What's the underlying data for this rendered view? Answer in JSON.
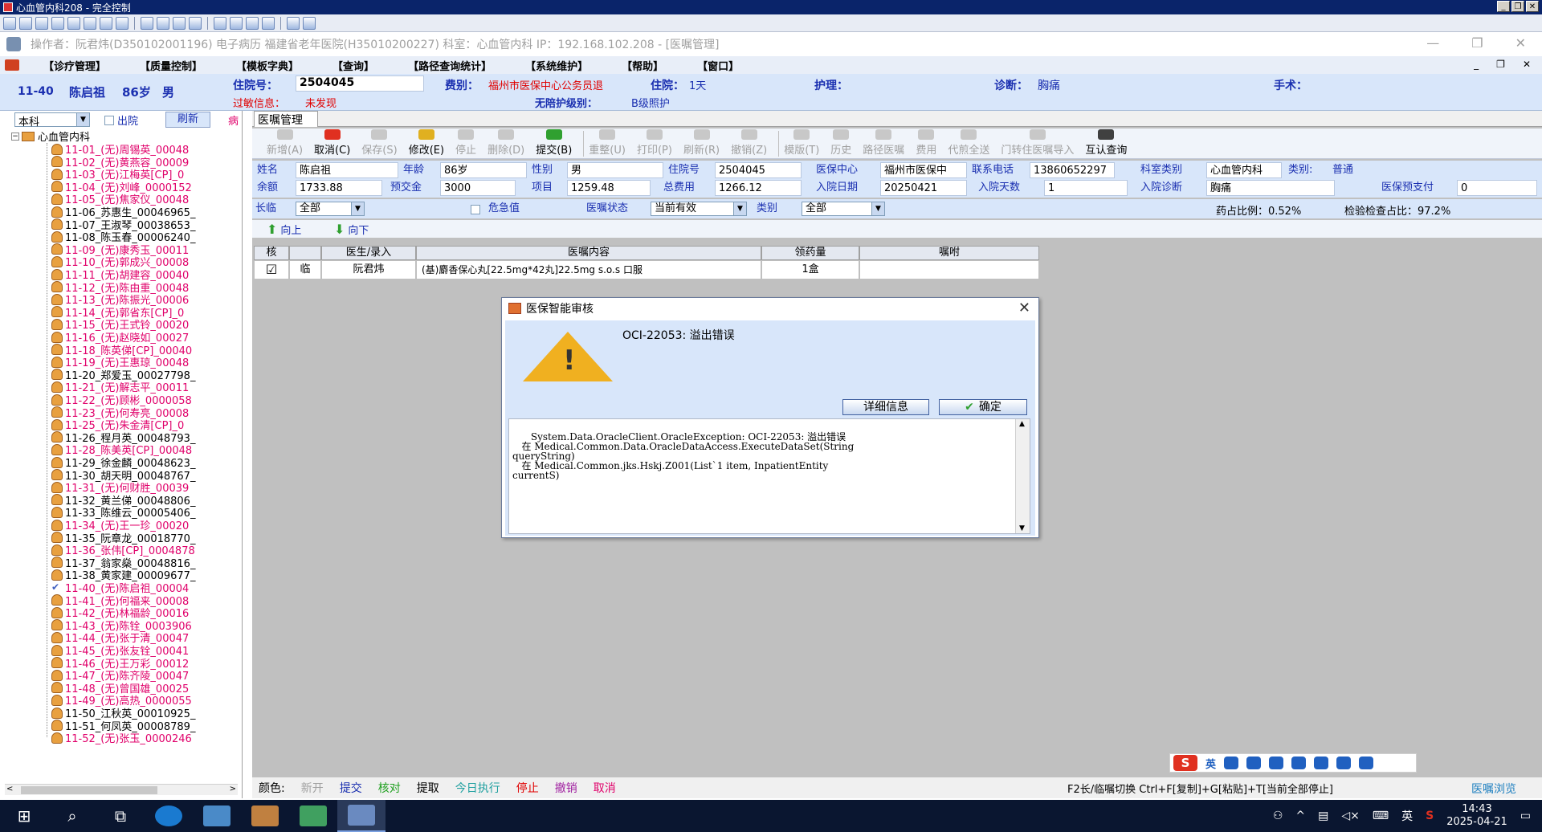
{
  "window": {
    "title": "心血管内科208 - 完全控制"
  },
  "appinfo": {
    "text": "操作者：阮君炜(D350102001196) 电子病历  福建省老年医院(H35010200227)  科室：心血管内科  IP：192.168.102.208 - [医嘱管理]",
    "min": "—",
    "max": "❐",
    "close": "✕"
  },
  "menu": {
    "items": [
      "【诊疗管理】",
      "【质量控制】",
      "【模板字典】",
      "【查询】",
      "【路径查询统计】",
      "【系统维护】",
      "【帮助】",
      "【窗口】"
    ],
    "mctl": [
      "_",
      "❐",
      "✕"
    ]
  },
  "patient": {
    "bed": "11-40",
    "name": "陈启祖",
    "age": "86岁",
    "sex": "男",
    "admission_label": "住院号：",
    "admission_no": "2504045",
    "allergy_label": "过敏信息：",
    "allergy_value": "未发现",
    "fee_label": "费别：",
    "fee_value": "福州市医保中心公务员退",
    "stay_label": "住院：",
    "stay_value": "1天",
    "care_level_label": "无陪护级别：",
    "care_level_value": "B级照护",
    "nursing_label": "护理：",
    "diag_label": "诊断：",
    "diag_value": "胸痛",
    "surgery_label": "手术："
  },
  "left": {
    "dept": "本科",
    "discharge_label": "出院",
    "refresh_label": "刷新",
    "tag": "病",
    "root": "心血管内科",
    "patients": [
      {
        "t": "11-01_(无)周锡英_00048",
        "c": "magenta"
      },
      {
        "t": "11-02_(无)黄燕容_00009",
        "c": "magenta"
      },
      {
        "t": "11-03_(无)江梅英[CP]_0",
        "c": "magenta"
      },
      {
        "t": "11-04_(无)刘峰_0000152",
        "c": "magenta"
      },
      {
        "t": "11-05_(无)焦家仪_00048",
        "c": "magenta"
      },
      {
        "t": "11-06_苏惠生_00046965_",
        "c": "black"
      },
      {
        "t": "11-07_王淑琴_00038653_",
        "c": "black"
      },
      {
        "t": "11-08_陈玉春_00006240_",
        "c": "black"
      },
      {
        "t": "11-09_(无)康秀玉_00011",
        "c": "magenta"
      },
      {
        "t": "11-10_(无)郭成兴_00008",
        "c": "magenta"
      },
      {
        "t": "11-11_(无)胡建容_00040",
        "c": "magenta"
      },
      {
        "t": "11-12_(无)陈由重_00048",
        "c": "magenta"
      },
      {
        "t": "11-13_(无)陈振光_00006",
        "c": "magenta"
      },
      {
        "t": "11-14_(无)郭省东[CP]_0",
        "c": "magenta"
      },
      {
        "t": "11-15_(无)王式铃_00020",
        "c": "magenta"
      },
      {
        "t": "11-16_(无)赵晓如_00027",
        "c": "magenta"
      },
      {
        "t": "11-18_陈英俤[CP]_00040",
        "c": "magenta"
      },
      {
        "t": "11-19_(无)王惠琼_00048",
        "c": "magenta"
      },
      {
        "t": "11-20_郑爱玉_00027798_",
        "c": "black"
      },
      {
        "t": "11-21_(无)解志平_00011",
        "c": "magenta"
      },
      {
        "t": "11-22_(无)顾彬_0000058",
        "c": "magenta"
      },
      {
        "t": "11-23_(无)何寿亮_00008",
        "c": "magenta"
      },
      {
        "t": "11-25_(无)朱金清[CP]_0",
        "c": "magenta"
      },
      {
        "t": "11-26_程月英_00048793_",
        "c": "black"
      },
      {
        "t": "11-28_陈美英[CP]_00048",
        "c": "magenta"
      },
      {
        "t": "11-29_徐金麟_00048623_",
        "c": "black"
      },
      {
        "t": "11-30_胡天明_00048767_",
        "c": "black"
      },
      {
        "t": "11-31_(无)何财胜_00039",
        "c": "magenta"
      },
      {
        "t": "11-32_黄兰俤_00048806_",
        "c": "black"
      },
      {
        "t": "11-33_陈维云_00005406_",
        "c": "black"
      },
      {
        "t": "11-34_(无)王一珍_00020",
        "c": "magenta"
      },
      {
        "t": "11-35_阮章龙_00018770_",
        "c": "black"
      },
      {
        "t": "11-36_张伟[CP]_0004878",
        "c": "magenta"
      },
      {
        "t": "11-37_翁家燊_00048816_",
        "c": "black"
      },
      {
        "t": "11-38_黄家建_00009677_",
        "c": "black"
      },
      {
        "t": "11-40_(无)陈启祖_00004",
        "c": "magenta",
        "checked": true
      },
      {
        "t": "11-41_(无)何福来_00008",
        "c": "magenta"
      },
      {
        "t": "11-42_(无)林福龄_00016",
        "c": "magenta"
      },
      {
        "t": "11-43_(无)陈铨_0003906",
        "c": "magenta"
      },
      {
        "t": "11-44_(无)张于清_00047",
        "c": "magenta"
      },
      {
        "t": "11-45_(无)张友铨_00041",
        "c": "magenta"
      },
      {
        "t": "11-46_(无)王万彩_00012",
        "c": "magenta"
      },
      {
        "t": "11-47_(无)陈齐陵_00047",
        "c": "magenta"
      },
      {
        "t": "11-48_(无)曾国雄_00025",
        "c": "magenta"
      },
      {
        "t": "11-49_(无)高热_0000055",
        "c": "magenta"
      },
      {
        "t": "11-50_江秋英_00010925_",
        "c": "black"
      },
      {
        "t": "11-51_何凤英_00008789_",
        "c": "black"
      },
      {
        "t": "11-52_(无)张玉_0000246",
        "c": "magenta"
      }
    ]
  },
  "tab": {
    "label": "医嘱管理"
  },
  "toolbar": [
    {
      "label": "新增(A)",
      "dis": true,
      "color": "#c8c8c8"
    },
    {
      "label": "取消(C)",
      "dis": false,
      "color": "#e03020"
    },
    {
      "label": "保存(S)",
      "dis": true,
      "color": "#c8c8c8"
    },
    {
      "label": "修改(E)",
      "dis": false,
      "color": "#e0b020"
    },
    {
      "label": "停止",
      "dis": true,
      "color": "#c8c8c8"
    },
    {
      "label": "删除(D)",
      "dis": true,
      "color": "#c8c8c8"
    },
    {
      "label": "提交(B)",
      "dis": false,
      "color": "#30a030"
    },
    {
      "label": "重整(U)",
      "dis": true,
      "color": "#c8c8c8"
    },
    {
      "label": "打印(P)",
      "dis": true,
      "color": "#c8c8c8"
    },
    {
      "label": "刷新(R)",
      "dis": true,
      "color": "#c8c8c8"
    },
    {
      "label": "撤销(Z)",
      "dis": true,
      "color": "#c8c8c8"
    },
    {
      "label": "模版(T)",
      "dis": true,
      "color": "#c8c8c8"
    },
    {
      "label": "历史",
      "dis": true,
      "color": "#c8c8c8"
    },
    {
      "label": "路径医嘱",
      "dis": true,
      "color": "#c8c8c8"
    },
    {
      "label": "费用",
      "dis": true,
      "color": "#c8c8c8"
    },
    {
      "label": "代煎全送",
      "dis": true,
      "color": "#c8c8c8"
    },
    {
      "label": "门转住医嘱导入",
      "dis": true,
      "color": "#c8c8c8"
    },
    {
      "label": "互认查询",
      "dis": false,
      "color": "#404040"
    }
  ],
  "info": {
    "name_l": "姓名",
    "name_v": "陈启祖",
    "age_l": "年龄",
    "age_v": "86岁",
    "sex_l": "性别",
    "sex_v": "男",
    "adm_l": "住院号",
    "adm_v": "2504045",
    "ins_l": "医保中心",
    "ins_v": "福州市医保中",
    "tel_l": "联系电话",
    "tel_v": "13860652297",
    "dept_l": "科室类别",
    "dept_v": "心血管内科",
    "cat_l": "类别:",
    "cat_v": "普通",
    "bal_l": "余额",
    "bal_v": "1733.88",
    "dep_l": "预交金",
    "dep_v": "3000",
    "item_l": "项目",
    "item_v": "1259.48",
    "tot_l": "总费用",
    "tot_v": "1266.12",
    "date_l": "入院日期",
    "date_v": "20250421",
    "days_l": "入院天数",
    "days_v": "1",
    "diag_l": "入院诊断",
    "diag_v": "胸痛",
    "pre_l": "医保预支付",
    "pre_v": "0"
  },
  "filter": {
    "long_l": "长临",
    "long_v": "全部",
    "crit_l": "危急值",
    "status_l": "医嘱状态",
    "status_v": "当前有效",
    "type_l": "类别",
    "type_v": "全部",
    "drug_ratio": "药占比例：0.52%",
    "exam_ratio": "检验检查占比：97.2%"
  },
  "nav": {
    "up": "向上",
    "down": "向下"
  },
  "grid": {
    "headers": [
      "核",
      "",
      "医生/录入",
      "医嘱内容",
      "领药量",
      "嘱咐"
    ],
    "row": {
      "check": "☑",
      "type": "临",
      "doctor": "阮君炜",
      "content": "(基)麝香保心丸[22.5mg*42丸]22.5mg   s.o.s 口服",
      "qty": "1盒",
      "note": ""
    }
  },
  "dialog": {
    "title": "医保智能审核",
    "message": "OCI-22053: 溢出错误",
    "detail_btn": "详细信息",
    "ok_btn": "确定",
    "close": "✕",
    "text": "System.Data.OracleClient.OracleException: OCI-22053: 溢出错误\n   在 Medical.Common.Data.OracleDataAccess.ExecuteDataSet(String\nqueryString)\n   在 Medical.Common.jks.Hskj.Z001(List`1 item, InpatientEntity\ncurrentS)"
  },
  "statusbar": {
    "items": [
      {
        "t": "颜色:",
        "c": "#000"
      },
      {
        "t": "新开",
        "c": "#a0a0a0"
      },
      {
        "t": "提交",
        "c": "#1a2fb0"
      },
      {
        "t": "核对",
        "c": "#20a020"
      },
      {
        "t": "提取",
        "c": "#000"
      },
      {
        "t": "今日执行",
        "c": "#20a0a0"
      },
      {
        "t": "停止",
        "c": "#e00000"
      },
      {
        "t": "撤销",
        "c": "#a020a0"
      },
      {
        "t": "取消",
        "c": "#e0006a"
      }
    ],
    "hint": "F2长/临嘱切换 Ctrl+F[复制]+G[粘贴]+T[当前全部停止]",
    "browse": "医嘱浏览"
  },
  "ime": {
    "s": "S",
    "lang": "英"
  },
  "taskbar": {
    "time": "14:43",
    "date": "2025-04-21",
    "lang": "英"
  }
}
